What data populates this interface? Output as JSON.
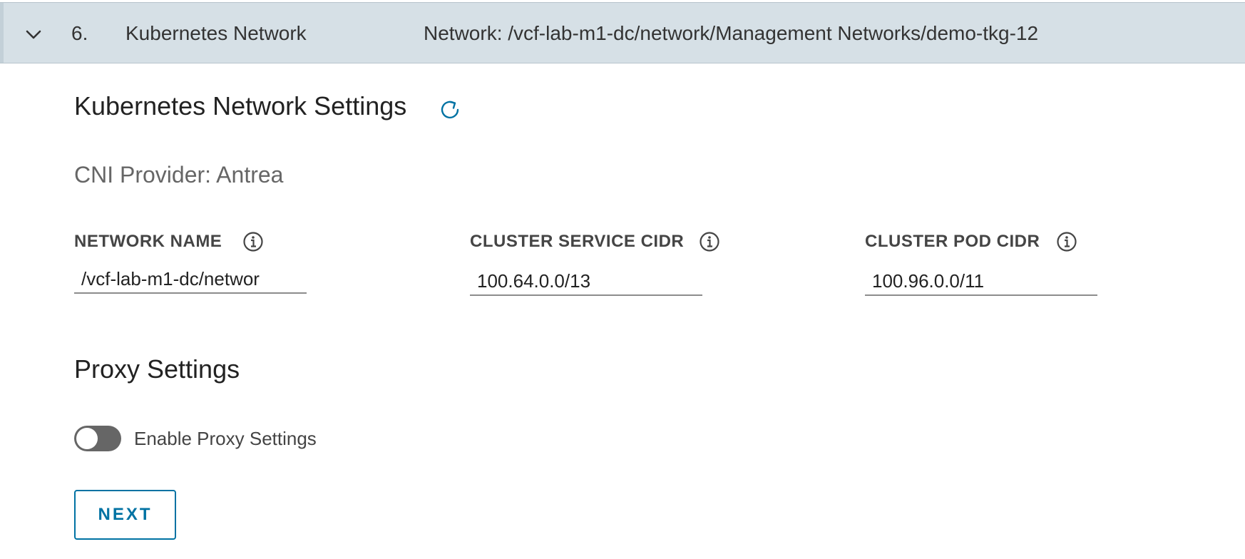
{
  "step": {
    "number": "6.",
    "title": "Kubernetes Network",
    "summary": "Network: /vcf-lab-m1-dc/network/Management Networks/demo-tkg-12"
  },
  "section": {
    "title": "Kubernetes Network Settings",
    "refresh_icon": "refresh-icon"
  },
  "cni": {
    "text": "CNI Provider: Antrea"
  },
  "fields": [
    {
      "label": "NETWORK NAME",
      "value": "/vcf-lab-m1-dc/networ",
      "info_icon": "info-icon"
    },
    {
      "label": "CLUSTER SERVICE CIDR",
      "value": "100.64.0.0/13",
      "info_icon": "info-icon"
    },
    {
      "label": "CLUSTER POD CIDR",
      "value": "100.96.0.0/11",
      "info_icon": "info-icon"
    }
  ],
  "proxy": {
    "title": "Proxy Settings",
    "toggle_label": "Enable Proxy Settings",
    "enabled": false
  },
  "actions": {
    "next_label": "NEXT"
  },
  "colors": {
    "header_bg": "#d6e0e6",
    "accent": "#0072a3",
    "toggle_off": "#666666"
  }
}
